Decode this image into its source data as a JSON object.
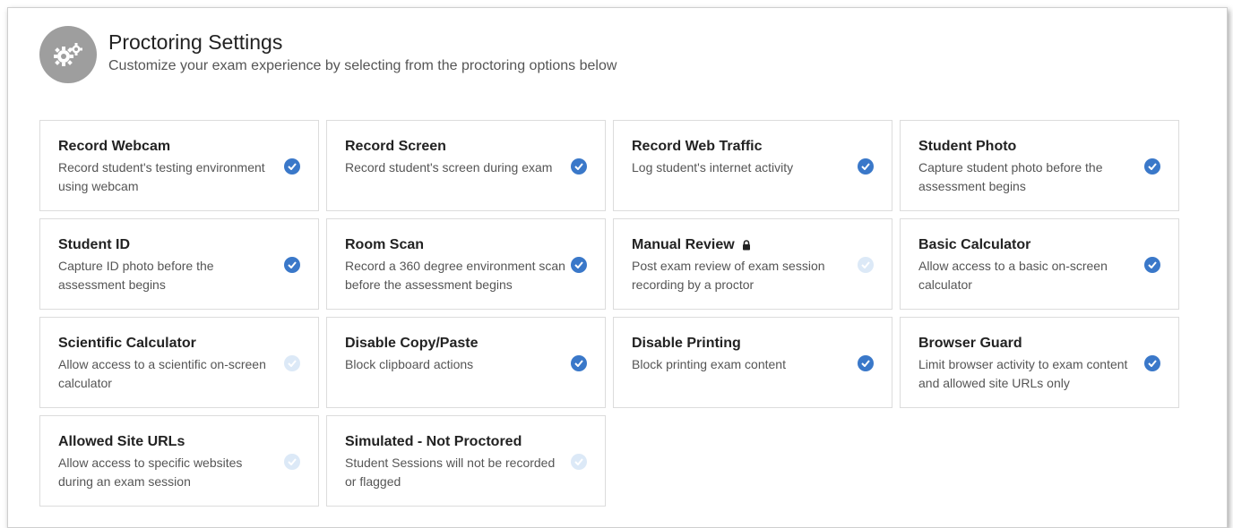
{
  "header": {
    "title": "Proctoring Settings",
    "subtitle": "Customize your exam experience by selecting from the proctoring options below",
    "icon": "gears-icon"
  },
  "colors": {
    "accent": "#3a78c9",
    "disabled_check": "#dce9f7",
    "icon_circle": "#9e9e9e"
  },
  "options": [
    {
      "title": "Record Webcam",
      "description": "Record student's testing environment using webcam",
      "checked": true
    },
    {
      "title": "Record Screen",
      "description": "Record student's screen during exam",
      "checked": true
    },
    {
      "title": "Record Web Traffic",
      "description": "Log student's internet activity",
      "checked": true
    },
    {
      "title": "Student Photo",
      "description": "Capture student photo before the assessment begins",
      "checked": true
    },
    {
      "title": "Student ID",
      "description": "Capture ID photo before the assessment begins",
      "checked": true
    },
    {
      "title": "Room Scan",
      "description": "Record a 360 degree environment scan before the assessment begins",
      "checked": true
    },
    {
      "title": "Manual Review",
      "description": "Post exam review of exam session recording by a proctor",
      "checked": false,
      "locked": true
    },
    {
      "title": "Basic Calculator",
      "description": "Allow access to a basic on-screen calculator",
      "checked": true
    },
    {
      "title": "Scientific Calculator",
      "description": "Allow access to a scientific on-screen calculator",
      "checked": false
    },
    {
      "title": "Disable Copy/Paste",
      "description": "Block clipboard actions",
      "checked": true
    },
    {
      "title": "Disable Printing",
      "description": "Block printing exam content",
      "checked": true
    },
    {
      "title": "Browser Guard",
      "description": "Limit browser activity to exam content and allowed site URLs only",
      "checked": true
    },
    {
      "title": "Allowed Site URLs",
      "description": "Allow access to specific websites during an exam session",
      "checked": false
    },
    {
      "title": "Simulated - Not Proctored",
      "description": "Student Sessions will not be recorded or flagged",
      "checked": false
    }
  ]
}
